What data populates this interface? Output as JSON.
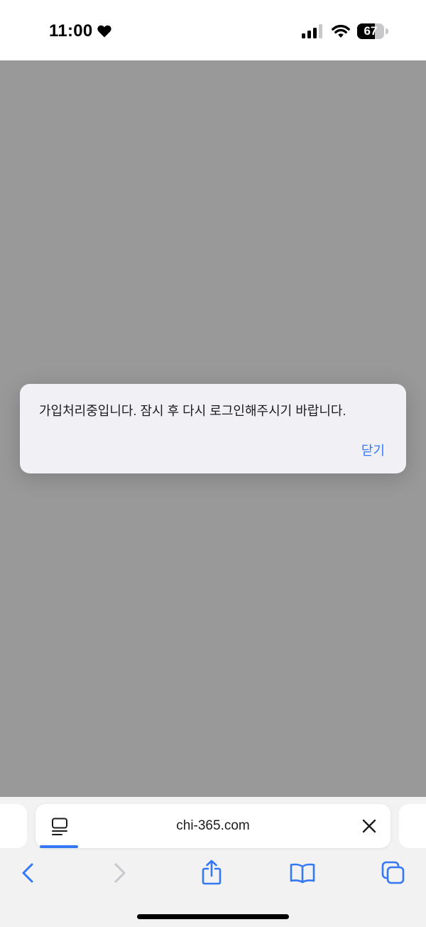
{
  "status_bar": {
    "time": "11:00",
    "battery_level": "67",
    "battery_fraction": 0.67,
    "icons": [
      "heart-icon",
      "cellular-signal-icon",
      "wifi-icon",
      "battery-icon"
    ]
  },
  "dialog": {
    "message": "가입처리중입니다. 잠시 후 다시 로그인해주시기 바랍니다.",
    "close_label": "닫기"
  },
  "browser": {
    "url": "chi-365.com",
    "icons": [
      "reader-mode-icon",
      "clear-icon",
      "back-chevron-icon",
      "forward-chevron-icon",
      "share-icon",
      "bookmarks-icon",
      "tabs-icon"
    ]
  },
  "colors": {
    "accent": "#3478f6",
    "overlay_background": "#999999",
    "dialog_background": "#f0f0f5",
    "toolbar_background": "#f2f2f2",
    "disabled": "#c7c7cc"
  }
}
